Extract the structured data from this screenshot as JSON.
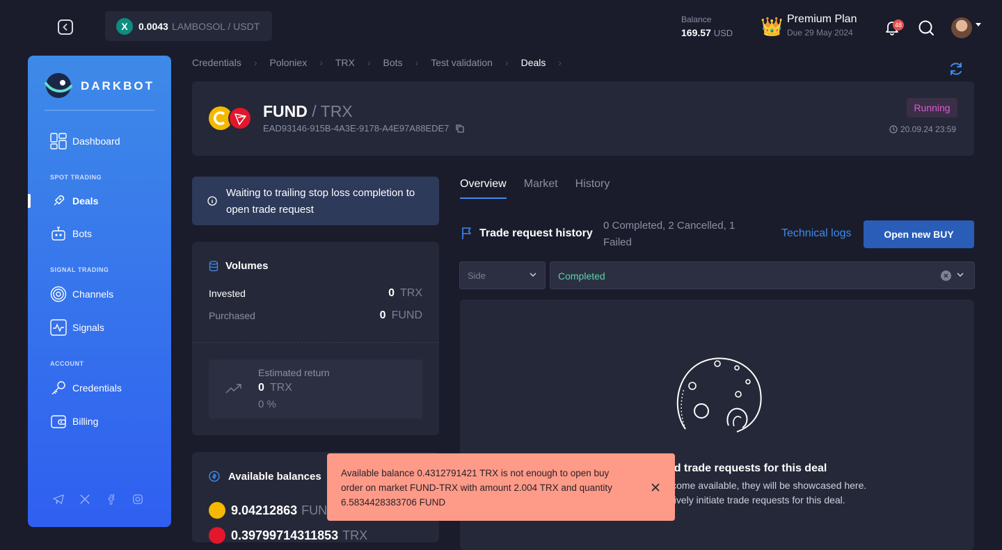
{
  "topbar": {
    "ticker_price": "0.0043",
    "ticker_pair": "LAMBOSOL / USDT",
    "balance_label": "Balance",
    "balance_value": "169.57",
    "balance_currency": "USD",
    "plan_name": "Premium Plan",
    "plan_due": "Due 29 May 2024",
    "notifications_count": "48"
  },
  "sidebar": {
    "brand": "DARKBOT",
    "items": [
      {
        "label": "Dashboard"
      },
      {
        "label": "Deals"
      },
      {
        "label": "Bots"
      },
      {
        "label": "Channels"
      },
      {
        "label": "Signals"
      },
      {
        "label": "Credentials"
      },
      {
        "label": "Billing"
      }
    ],
    "sections": [
      "SPOT TRADING",
      "SIGNAL TRADING",
      "ACCOUNT"
    ]
  },
  "breadcrumb": [
    "Credentials",
    "Poloniex",
    "TRX",
    "Bots",
    "Test validation",
    "Deals"
  ],
  "deal": {
    "base": "FUND",
    "quote": "/ TRX",
    "id": "EAD93146-915B-4A3E-9178-A4E97A88EDE7",
    "status": "Running",
    "time": "20.09.24 23:59"
  },
  "info_message": "Waiting to trailing stop loss completion to open trade request",
  "volumes": {
    "title": "Volumes",
    "invested_label": "Invested",
    "invested_value": "0",
    "invested_unit": "TRX",
    "purchased_label": "Purchased",
    "purchased_value": "0",
    "purchased_unit": "FUND",
    "est_label": "Estimated return",
    "est_value": "0",
    "est_unit": "TRX",
    "est_pct": "0 %"
  },
  "balances": {
    "title": "Available balances",
    "fund_value": "9.04212863",
    "fund_unit": "FUND",
    "trx_value": "0.39799714311853",
    "trx_unit": "TRX"
  },
  "tabs": [
    "Overview",
    "Market",
    "History"
  ],
  "trade_history": {
    "title": "Trade request history",
    "stats": "0 Completed, 2 Cancelled, 1 Failed",
    "tech_logs": "Technical logs",
    "open_buy": "Open new BUY",
    "side_placeholder": "Side",
    "status_value": "Completed",
    "empty_title": "No completed trade requests for this deal",
    "empty_line1": "When trade requests become available, they will be showcased here.",
    "empty_line2": "You can also proactively initiate trade requests for this deal."
  },
  "toast": {
    "message": "Available balance 0.4312791421 TRX is not enough to open buy order on market FUND-TRX with amount 2.004 TRX and quantity 6.5834428383706 FUND"
  },
  "colors": {
    "accent": "#3d8bef",
    "running": "#d85fd0",
    "completed": "#5ed2a8",
    "toast_bg": "#fd9b88"
  }
}
